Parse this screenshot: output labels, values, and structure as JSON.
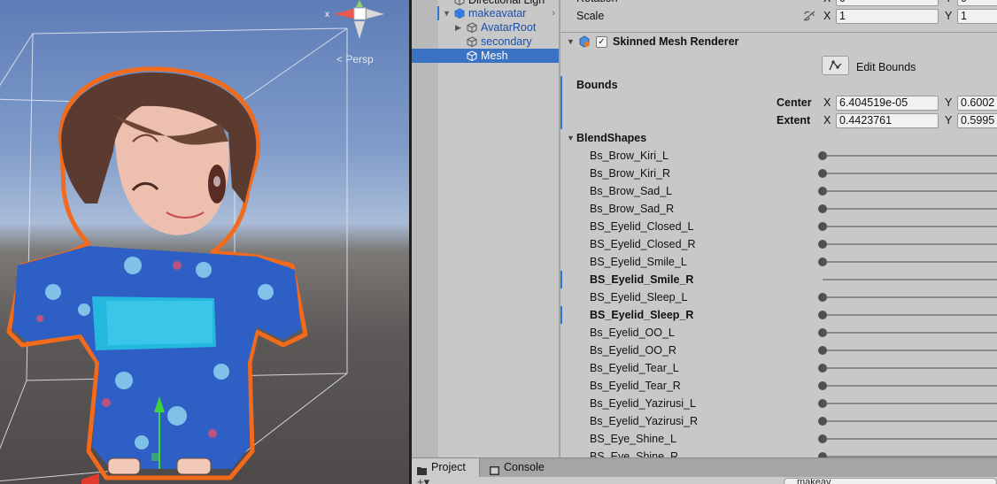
{
  "scene": {
    "persp_label": "< Persp",
    "gizmo_axis_label": "x"
  },
  "hierarchy": {
    "rows": [
      {
        "label": "Directional Ligh",
        "depth": 1,
        "expanded": null,
        "selected": false,
        "prefab": false
      },
      {
        "label": "makeavatar",
        "depth": 1,
        "expanded": true,
        "selected": false,
        "prefab": true
      },
      {
        "label": "AvatarRoot",
        "depth": 2,
        "expanded": false,
        "selected": false,
        "prefab": true
      },
      {
        "label": "secondary",
        "depth": 2,
        "expanded": null,
        "selected": false,
        "prefab": true
      },
      {
        "label": "Mesh",
        "depth": 2,
        "expanded": null,
        "selected": true,
        "prefab": true
      }
    ]
  },
  "inspector": {
    "transform": {
      "rotation_label": "Rotation",
      "rotation_x": "0",
      "rotation_y": "0",
      "scale_label": "Scale",
      "scale_x": "1",
      "scale_y": "1"
    },
    "axis_x": "X",
    "axis_y": "Y",
    "component": {
      "title": "Skinned Mesh Renderer",
      "enabled": true,
      "edit_bounds_label": "Edit Bounds"
    },
    "bounds": {
      "label": "Bounds",
      "center_label": "Center",
      "center_x": "6.404519e-05",
      "center_y": "0.6002",
      "extent_label": "Extent",
      "extent_x": "0.4423761",
      "extent_y": "0.5995"
    },
    "blendshapes": {
      "label": "BlendShapes",
      "items": [
        {
          "name": "Bs_Brow_Kiri_L",
          "value": 0,
          "modified": false
        },
        {
          "name": "Bs_Brow_Kiri_R",
          "value": 0,
          "modified": false
        },
        {
          "name": "Bs_Brow_Sad_L",
          "value": 0,
          "modified": false
        },
        {
          "name": "Bs_Brow_Sad_R",
          "value": 0,
          "modified": false
        },
        {
          "name": "BS_Eyelid_Closed_L",
          "value": 0,
          "modified": false
        },
        {
          "name": "BS_Eyelid_Closed_R",
          "value": 0,
          "modified": false
        },
        {
          "name": "BS_Eyelid_Smile_L",
          "value": 0,
          "modified": false
        },
        {
          "name": "BS_Eyelid_Smile_R",
          "value": 100,
          "modified": true
        },
        {
          "name": "BS_Eyelid_Sleep_L",
          "value": 0,
          "modified": false
        },
        {
          "name": "BS_Eyelid_Sleep_R",
          "value": 0,
          "modified": true
        },
        {
          "name": "Bs_Eyelid_OO_L",
          "value": 0,
          "modified": false
        },
        {
          "name": "Bs_Eyelid_OO_R",
          "value": 0,
          "modified": false
        },
        {
          "name": "Bs_Eyelid_Tear_L",
          "value": 0,
          "modified": false
        },
        {
          "name": "Bs_Eyelid_Tear_R",
          "value": 0,
          "modified": false
        },
        {
          "name": "Bs_Eyelid_Yazirusi_L",
          "value": 0,
          "modified": false
        },
        {
          "name": "Bs_Eyelid_Yazirusi_R",
          "value": 0,
          "modified": false
        },
        {
          "name": "BS_Eye_Shine_L",
          "value": 0,
          "modified": false
        },
        {
          "name": "BS_Eye_Shine_R",
          "value": 0,
          "modified": false
        }
      ]
    }
  },
  "bottom": {
    "tabs": [
      {
        "label": "Project",
        "active": true
      },
      {
        "label": "Console",
        "active": false
      }
    ],
    "search_value": "makeav"
  },
  "colors": {
    "selection": "#3a72c4",
    "modified_marker": "#2f78d6",
    "outline": "#f26a1b"
  }
}
